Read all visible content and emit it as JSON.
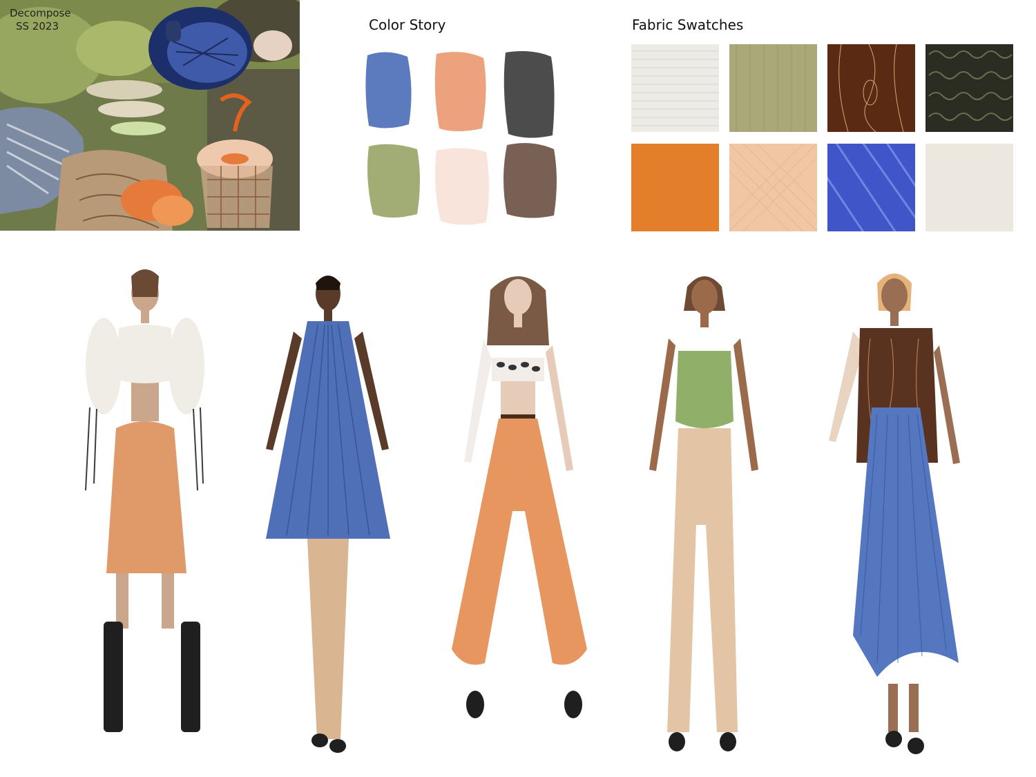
{
  "moodboard": {
    "title_line1": "Decompose",
    "title_line2": "SS 2023"
  },
  "color_story": {
    "title": "Color Story",
    "colors": [
      "#4e6fb8",
      "#e99a72",
      "#3d3d3d",
      "#9aa66a",
      "#f7e2d8",
      "#6d5247"
    ]
  },
  "fabric_swatches": {
    "title": "Fabric Swatches",
    "items": [
      {
        "name": "white-knit-swatch",
        "color": "#ecebe6"
      },
      {
        "name": "olive-gauze-swatch",
        "color": "#aaa878"
      },
      {
        "name": "brown-woodgrain-swatch",
        "color": "#5a2a12"
      },
      {
        "name": "black-boucle-swatch",
        "color": "#2b2c22"
      },
      {
        "name": "orange-suede-swatch",
        "color": "#e37f2a"
      },
      {
        "name": "peach-mesh-swatch",
        "color": "#f1c7a3"
      },
      {
        "name": "blue-pleat-swatch",
        "color": "#3f55c8"
      },
      {
        "name": "cream-terry-swatch",
        "color": "#ece8df"
      }
    ]
  },
  "figures": [
    {
      "name": "look-1-figure",
      "skin": "#caa68c",
      "top": "#f0ece6",
      "bottom": "#e09a6a",
      "shoes": "#1f1f1f"
    },
    {
      "name": "look-2-figure",
      "skin": "#5a3a28",
      "top": "#4f6fb7",
      "bottom": "#d9b591",
      "shoes": "#1f1f1f"
    },
    {
      "name": "look-3-figure",
      "skin": "#e6cbb8",
      "top": "#f2ede8",
      "bottom": "#e6965e",
      "shoes": "#1f1f1f"
    },
    {
      "name": "look-4-figure",
      "skin": "#9a6a4a",
      "top": "#90b06a",
      "bottom": "#e3c4a4",
      "shoes": "#1f1f1f"
    },
    {
      "name": "look-5-figure",
      "skin": "#9a6e52",
      "top": "#5a3220",
      "bottom": "#5577c0",
      "shoes": "#1f1f1f"
    }
  ]
}
